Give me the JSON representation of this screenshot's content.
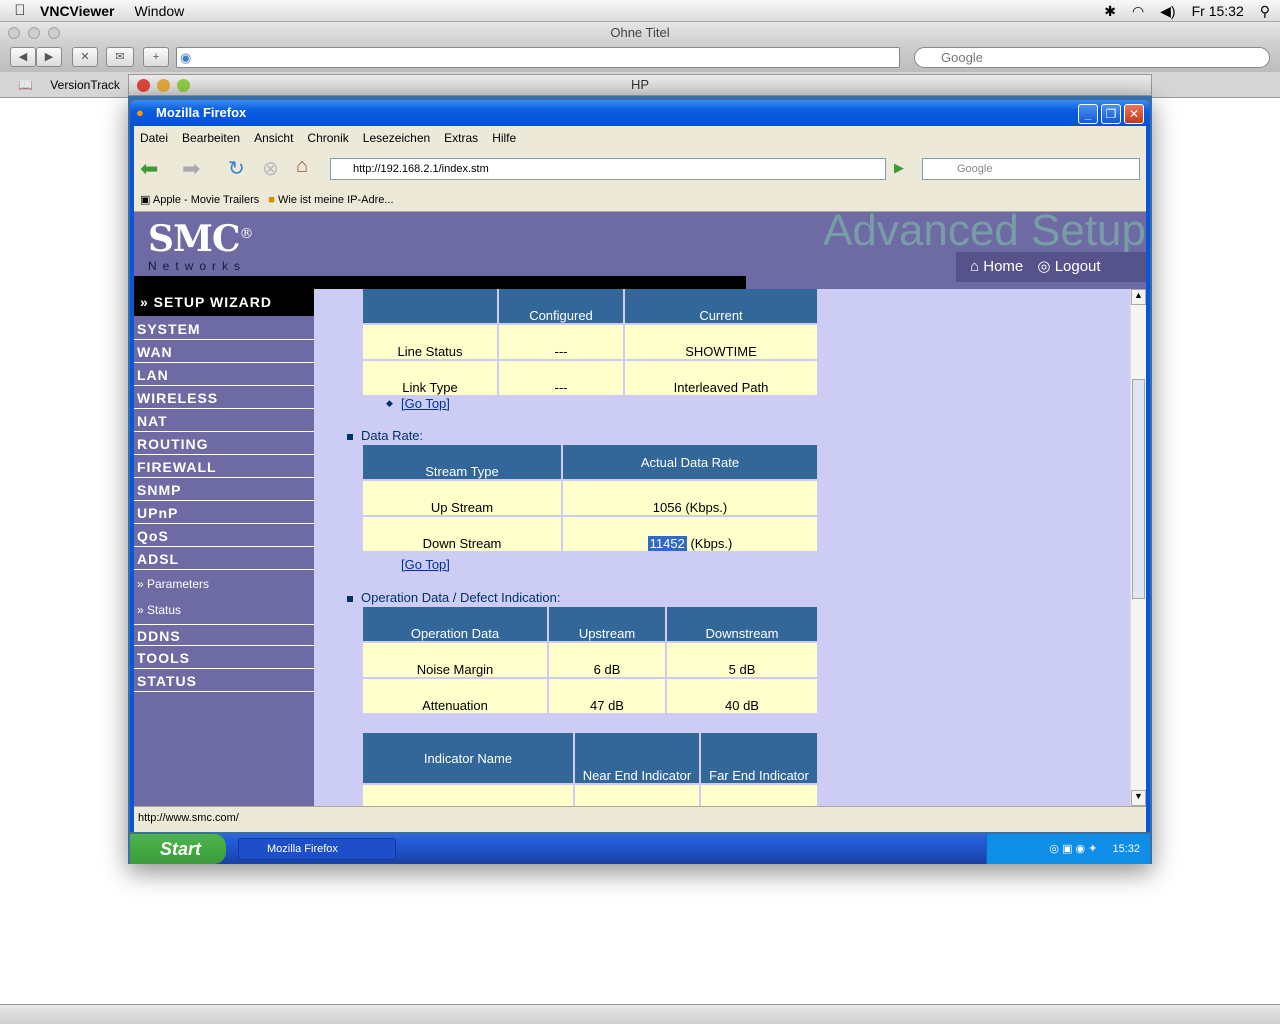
{
  "mac_menubar": {
    "app": "VNCViewer",
    "window_menu": "Window",
    "clock": "Fr 15:32"
  },
  "safari": {
    "title": "Ohne Titel",
    "search_placeholder": "Google",
    "bookmark": "VersionTrack"
  },
  "vnc": {
    "title": "HP"
  },
  "firefox": {
    "title": "Mozilla Firefox",
    "menu": [
      "Datei",
      "Bearbeiten",
      "Ansicht",
      "Chronik",
      "Lesezeichen",
      "Extras",
      "Hilfe"
    ],
    "url": "http://192.168.2.1/index.stm",
    "search_placeholder": "Google",
    "bookmarks": [
      "Apple - Movie Trailers",
      "Wie ist meine IP-Adre..."
    ],
    "status_text": "http://www.smc.com/"
  },
  "router": {
    "logo": "SMC",
    "logo_reg": "®",
    "logo_sub": "Networks",
    "banner": "Advanced Setup",
    "home": "Home",
    "logout": "Logout",
    "wizard": "» SETUP WIZARD",
    "nav": [
      "SYSTEM",
      "WAN",
      "LAN",
      "WIRELESS",
      "NAT",
      "ROUTING",
      "FIREWALL",
      "SNMP",
      "UPnP",
      "QoS",
      "ADSL"
    ],
    "nav_sub": [
      "» Parameters",
      "» Status"
    ],
    "nav_after": [
      "DDNS",
      "TOOLS",
      "STATUS"
    ],
    "line_table": {
      "headers": [
        "",
        "Configured",
        "Current"
      ],
      "rows": [
        [
          "Line Status",
          "---",
          "SHOWTIME"
        ],
        [
          "Link Type",
          "---",
          "Interleaved Path"
        ]
      ]
    },
    "go_top": "[Go Top]",
    "data_rate_title": "Data Rate:",
    "rate_table": {
      "headers": [
        "Stream Type",
        "Actual Data Rate"
      ],
      "rows": [
        [
          "Up Stream",
          "1056 (Kbps.)"
        ],
        [
          "Down Stream",
          "11452 (Kbps.)"
        ]
      ]
    },
    "selected_text": "11452",
    "op_title": "Operation Data / Defect Indication:",
    "op_table": {
      "headers": [
        "Operation Data",
        "Upstream",
        "Downstream"
      ],
      "rows": [
        [
          "Noise Margin",
          "6 dB",
          "5 dB"
        ],
        [
          "Attenuation",
          "47 dB",
          "40 dB"
        ]
      ]
    },
    "ind_table": {
      "headers": [
        "Indicator Name",
        "Near End Indicator",
        "Far End Indicator"
      ]
    }
  },
  "taskbar": {
    "start": "Start",
    "task": "Mozilla Firefox",
    "clock": "15:32"
  }
}
